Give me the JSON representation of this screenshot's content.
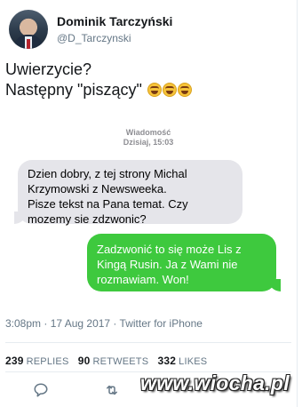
{
  "tweet": {
    "author_name": "Dominik Tarczyński",
    "author_handle": "@D_Tarczynski",
    "text_line1": "Uwierzycie?",
    "text_line2": "Następny \"piszący\"",
    "emoji": [
      "face-with-tears-of-joy-icon",
      "face-with-tears-of-joy-icon",
      "face-with-tears-of-joy-icon"
    ],
    "timestamp": "3:08pm · 17 Aug 2017 · Twitter for iPhone"
  },
  "sms": {
    "header_title": "Wiadomość",
    "header_time": "Dzisiaj, 15:03",
    "incoming_lines": [
      "Dzien dobry, z tej strony Michal",
      "Krzymowski z Newsweeka.",
      "Pisze tekst na Pana temat. Czy",
      "mozemy sie zdzwonic?"
    ],
    "outgoing_lines": [
      "Zadzwonić to się może Lis z",
      "Kingą Rusin. Ja z Wami nie",
      "rozmawiam. Won!"
    ],
    "colors": {
      "incoming": "#e5e5ea",
      "outgoing": "#3ec93e"
    }
  },
  "stats": {
    "replies_count": "239",
    "replies_label": "REPLIES",
    "retweets_count": "90",
    "retweets_label": "RETWEETS",
    "likes_count": "332",
    "likes_label": "LIKES"
  },
  "actions": [
    "reply-icon",
    "retweet-icon"
  ],
  "watermark": "www.wiocha.pl"
}
